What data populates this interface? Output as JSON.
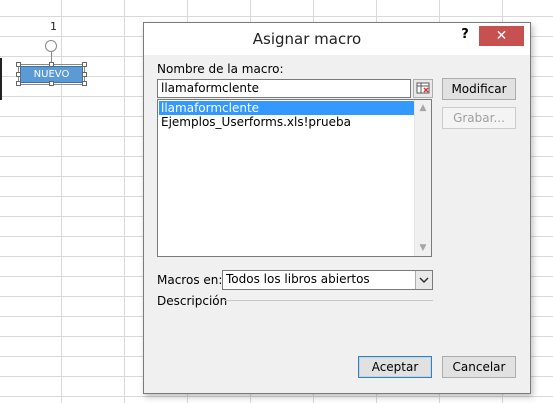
{
  "sheet": {
    "row_number": "1",
    "shape_label": "NUEVO"
  },
  "dialog": {
    "title": "Asignar macro",
    "help_label": "?",
    "close_label": "✕",
    "macro_name_label": "Nombre de la macro:",
    "macro_name_value": "llamaformclente",
    "macro_list": [
      {
        "name": "llamaformclente",
        "selected": true
      },
      {
        "name": "Ejemplos_Userforms.xls!prueba",
        "selected": false
      }
    ],
    "buttons": {
      "modify": "Modificar",
      "record": "Grabar...",
      "accept": "Aceptar",
      "cancel": "Cancelar"
    },
    "macros_in_label": "Macros en:",
    "macros_in_value": "Todos los libros abiertos",
    "description_label": "Descripción"
  },
  "colors": {
    "shape_fill": "#5b9bd5",
    "selection_highlight": "#3399ff",
    "close_button": "#c75050"
  },
  "icons": {
    "ref_button": "range-select-icon",
    "combo_arrow": "chevron-down-icon",
    "scroll_up": "scroll-up-arrow-icon",
    "scroll_down": "scroll-down-arrow-icon",
    "rotate": "rotate-handle-icon"
  }
}
